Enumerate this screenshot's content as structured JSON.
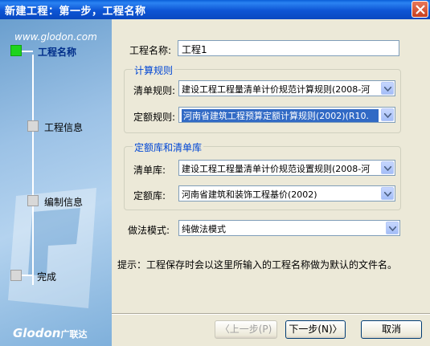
{
  "window": {
    "title": "新建工程：第一步，工程名称"
  },
  "sidebar": {
    "url": "www.glodon.com",
    "steps": [
      {
        "label": "工程名称",
        "active": true
      },
      {
        "label": "工程信息",
        "active": false
      },
      {
        "label": "编制信息",
        "active": false
      },
      {
        "label": "完成",
        "active": false
      }
    ],
    "logo": "Glodon",
    "logo_cn": "广联达"
  },
  "form": {
    "project_name_label": "工程名称:",
    "project_name_value": "工程1",
    "rules_group": {
      "title": "计算规则",
      "bill_rule_label": "清单规则:",
      "bill_rule_value": "建设工程工程量清单计价规范计算规则(2008-河",
      "quota_rule_label": "定额规则:",
      "quota_rule_value": "河南省建筑工程预算定额计算规则(2002)(R10."
    },
    "lib_group": {
      "title": "定额库和清单库",
      "bill_lib_label": "清单库:",
      "bill_lib_value": "建设工程工程量清单计价规范设置规则(2008-河",
      "quota_lib_label": "定额库:",
      "quota_lib_value": "河南省建筑和装饰工程基价(2002)"
    },
    "method_label": "做法模式:",
    "method_value": "纯做法模式",
    "hint": "提示：工程保存时会以这里所输入的工程名称做为默认的文件名。"
  },
  "buttons": {
    "prev": "〈上一步(P)",
    "next": "下一步(N)〉",
    "cancel": "取消"
  },
  "colors": {
    "title_bar": "#0848c0",
    "active_step": "#1ed41e",
    "group_title": "#0046d5"
  }
}
